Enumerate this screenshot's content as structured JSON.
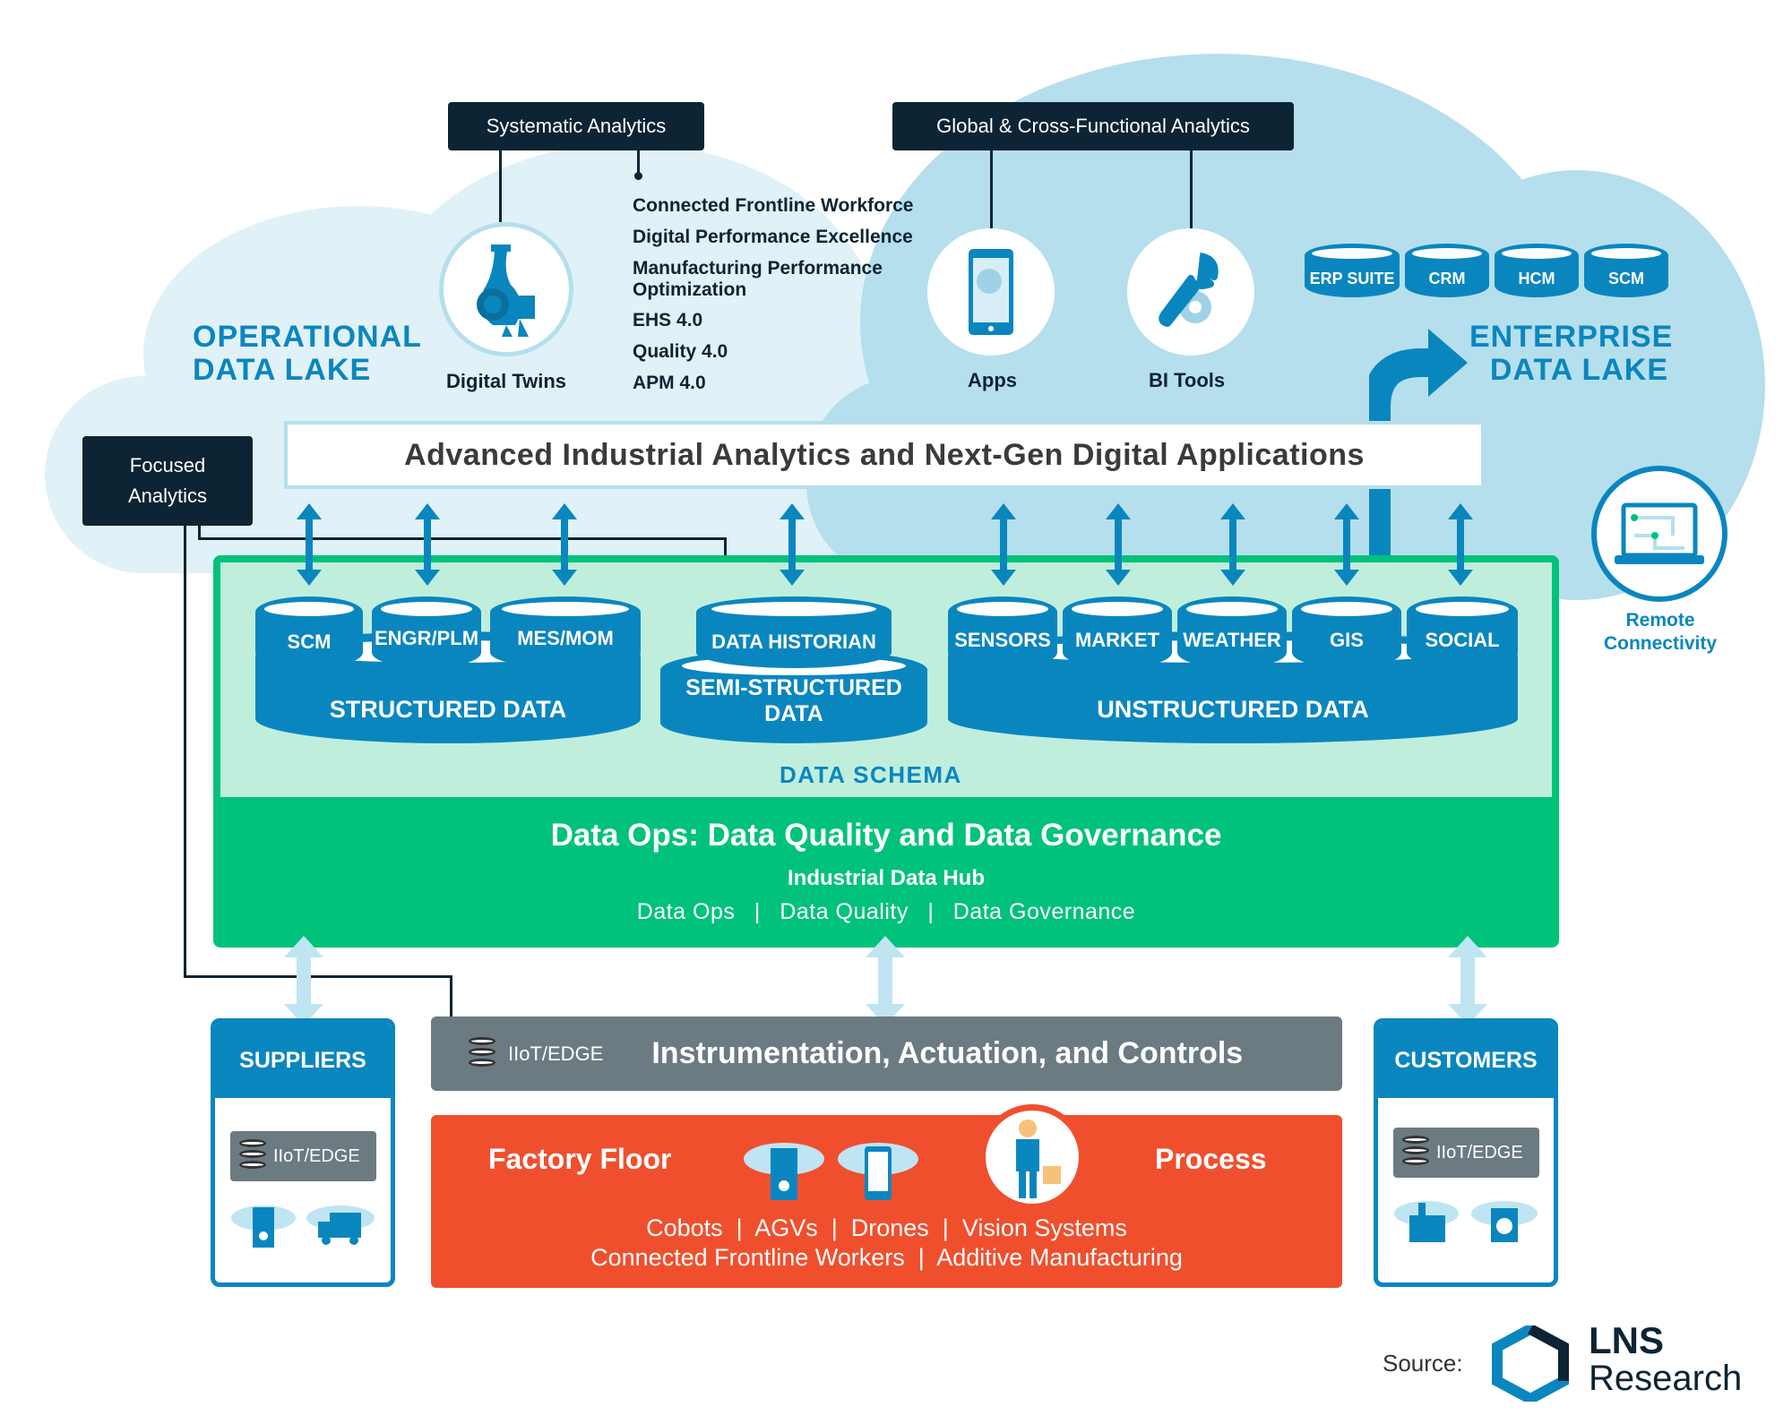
{
  "clouds": {
    "operational": {
      "line1": "OPERATIONAL",
      "line2": "DATA LAKE"
    },
    "enterprise": {
      "line1": "ENTERPRISE",
      "line2": "DATA LAKE"
    }
  },
  "analytics_boxes": {
    "systematic": "Systematic Analytics",
    "global": "Global & Cross-Functional Analytics",
    "focused_line1": "Focused",
    "focused_line2": "Analytics"
  },
  "digital_twins": {
    "label": "Digital Twins"
  },
  "systematic_items": [
    "Connected Frontline Workforce",
    "Digital Performance Excellence",
    "Manufacturing Performance",
    "Optimization",
    "EHS 4.0",
    "Quality 4.0",
    "APM 4.0"
  ],
  "global_items": {
    "apps": "Apps",
    "bi_tools": "BI Tools"
  },
  "enterprise_dbs": [
    "ERP SUITE",
    "CRM",
    "HCM",
    "SCM"
  ],
  "banner": {
    "title": "Advanced Industrial Analytics and Next-Gen Digital Applications"
  },
  "remote": {
    "line1": "Remote",
    "line2": "Connectivity"
  },
  "data_schema": {
    "label": "DATA SCHEMA",
    "structured": {
      "label": "STRUCTURED DATA",
      "items": [
        "SCM",
        "ENGR/PLM",
        "MES/MOM"
      ]
    },
    "semi": {
      "label": "SEMI-STRUCTURED DATA",
      "items": [
        "DATA HISTORIAN"
      ]
    },
    "unstructured": {
      "label": "UNSTRUCTURED DATA",
      "items": [
        "SENSORS",
        "MARKET",
        "WEATHER",
        "GIS",
        "SOCIAL"
      ]
    }
  },
  "dataops": {
    "title": "Data Ops: Data Quality and Data Governance",
    "subtitle": "Industrial Data Hub",
    "items": [
      "Data Ops",
      "Data Quality",
      "Data Governance"
    ],
    "sep": "|"
  },
  "suppliers": {
    "title": "SUPPLIERS",
    "edge": "IIoT/EDGE"
  },
  "customers": {
    "title": "CUSTOMERS",
    "edge": "IIoT/EDGE"
  },
  "instrumentation": {
    "edge": "IIoT/EDGE",
    "title": "Instrumentation, Actuation, and Controls"
  },
  "factory": {
    "left": "Factory Floor",
    "right": "Process",
    "line1": "Cobots  |  AGVs  |  Drones  |  Vision Systems",
    "line2": "Connected Frontline Workers  |  Additive Manufacturing"
  },
  "source": {
    "label": "Source:",
    "brand1": "LNS",
    "brand2": "Research"
  },
  "colors": {
    "blue": "#0a86bf",
    "dark": "#0c2433",
    "green": "#00c27a",
    "mint": "#c0eedd",
    "orange": "#f04f2e",
    "gray": "#6c7a82"
  }
}
